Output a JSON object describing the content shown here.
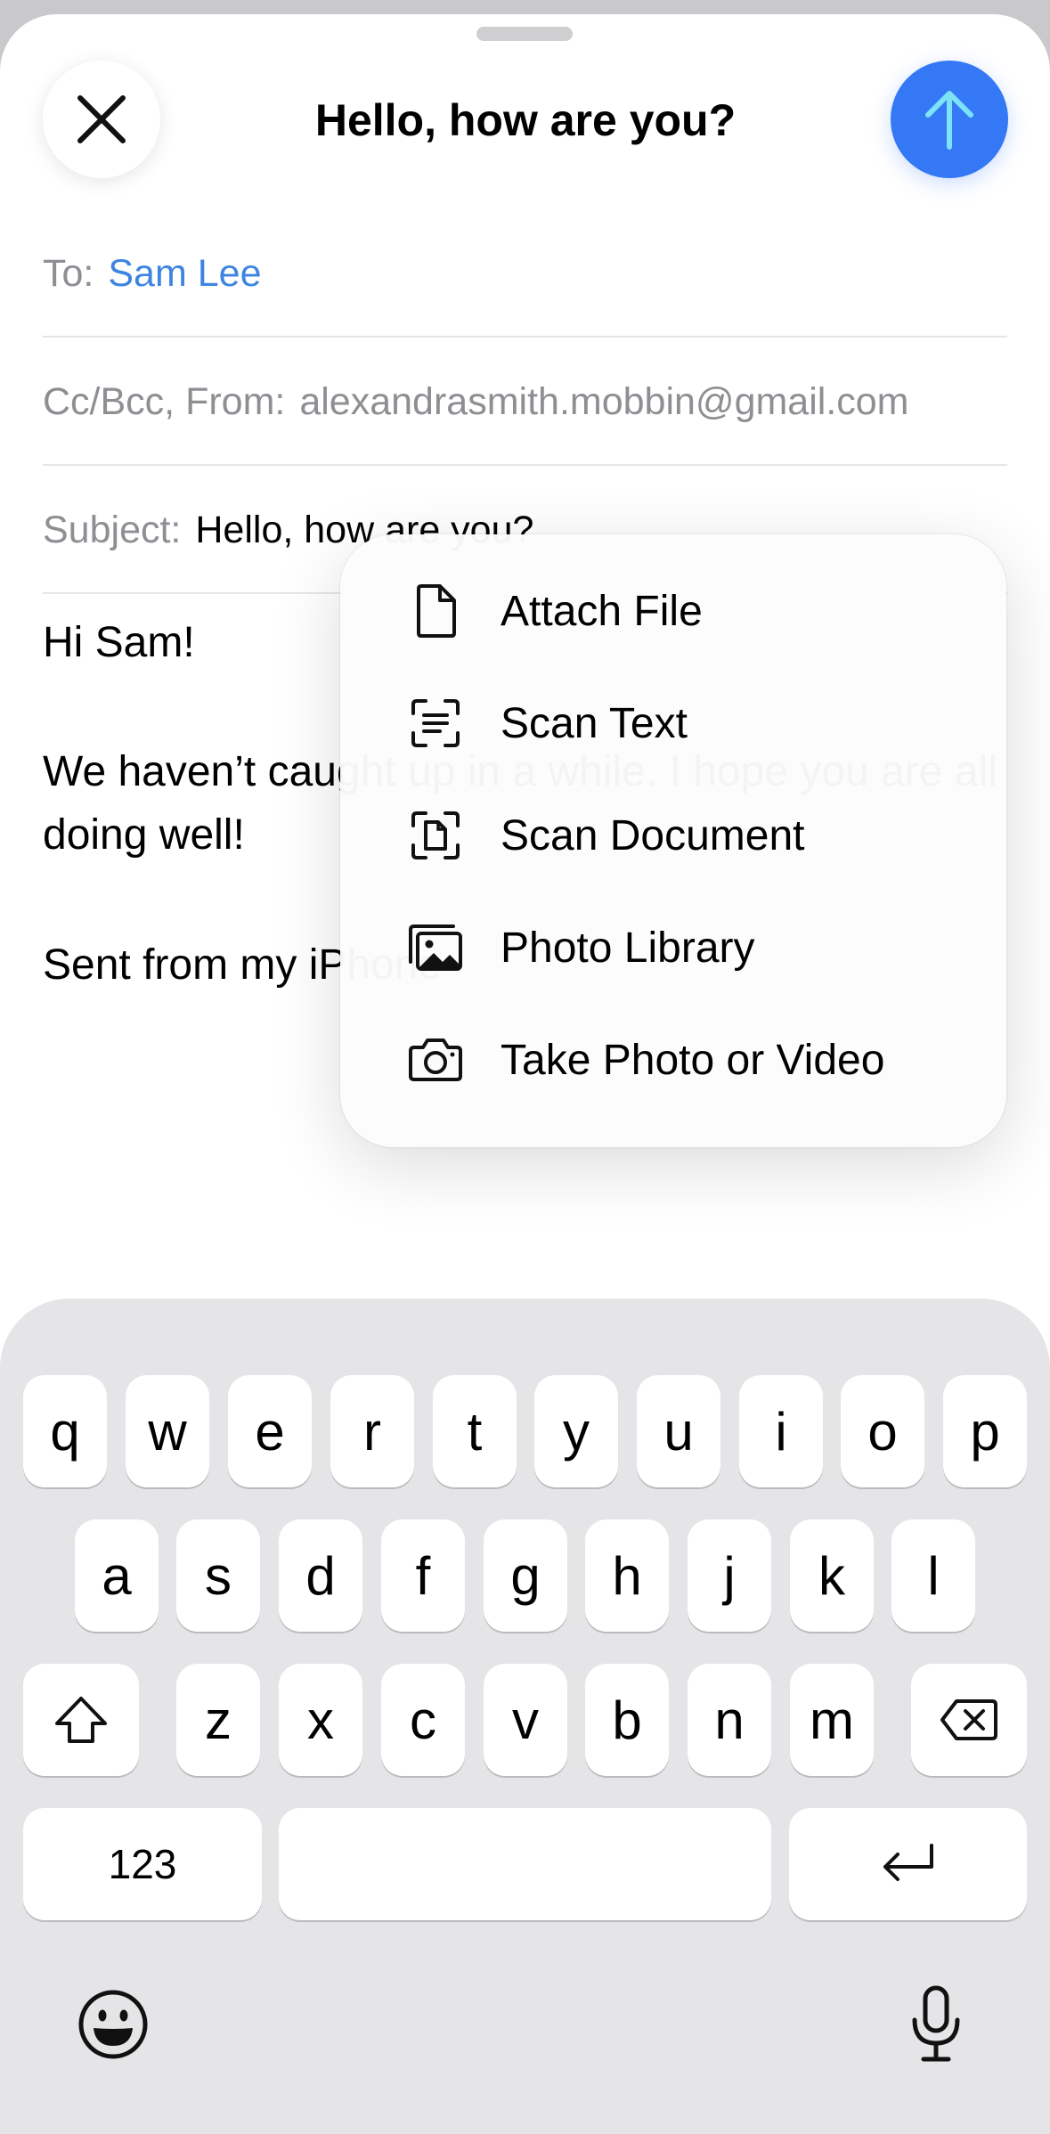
{
  "header": {
    "title": "Hello, how are you?",
    "close_icon": "close-x-icon",
    "send_icon": "arrow-up-icon",
    "send_color": "#3478f6"
  },
  "fields": {
    "to_label": "To:",
    "to_value": "Sam Lee",
    "ccbcc_label": "Cc/Bcc, From:",
    "from_value": "alexandrasmith.mobbin@gmail.com",
    "subject_label": "Subject:",
    "subject_value": "Hello, how are you?"
  },
  "body": {
    "line1": "Hi Sam!",
    "line2": "We haven’t caught up in a while. I hope you are all",
    "line3": "doing well!",
    "line4": "Sent from my iPhone"
  },
  "attach_menu": {
    "items": [
      {
        "label": "Attach File",
        "icon": "document-icon"
      },
      {
        "label": "Scan Text",
        "icon": "scan-text-icon"
      },
      {
        "label": "Scan Document",
        "icon": "scan-document-icon"
      },
      {
        "label": "Photo Library",
        "icon": "photo-library-icon"
      },
      {
        "label": "Take Photo or Video",
        "icon": "camera-icon"
      }
    ]
  },
  "keyboard": {
    "row1": [
      "q",
      "w",
      "e",
      "r",
      "t",
      "y",
      "u",
      "i",
      "o",
      "p"
    ],
    "row2": [
      "a",
      "s",
      "d",
      "f",
      "g",
      "h",
      "j",
      "k",
      "l"
    ],
    "row3": [
      "z",
      "x",
      "c",
      "v",
      "b",
      "n",
      "m"
    ],
    "numbers_label": "123",
    "space_label": "",
    "shift_icon": "shift-icon",
    "delete_icon": "delete-backward-icon",
    "return_icon": "return-icon",
    "emoji_icon": "emoji-icon",
    "mic_icon": "microphone-icon"
  }
}
